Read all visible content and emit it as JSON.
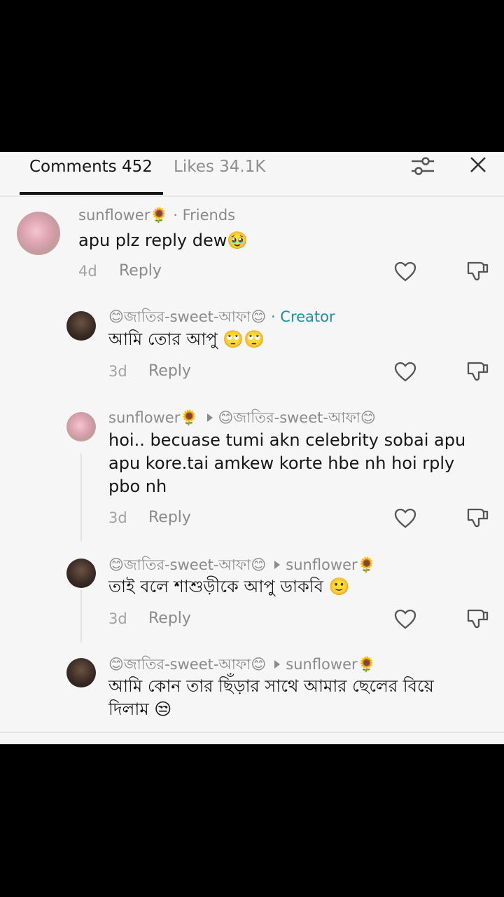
{
  "tabs": {
    "comments": "Comments 452",
    "likes": "Likes 34.1K"
  },
  "comments": [
    {
      "username": "sunflower",
      "user_emoji": "🌻",
      "badge": "· Friends",
      "text": "apu plz reply dew🥹",
      "age": "4d",
      "reply_label": "Reply"
    },
    {
      "username": "😊জাতির-sweet-আফা😊",
      "badge": "· Creator",
      "text": "আমি তোর আপু 🙄🙄",
      "age": "3d",
      "reply_label": "Reply"
    },
    {
      "username": "sunflower",
      "user_emoji": "🌻",
      "reply_to": "😊জাতির-sweet-আফা😊",
      "text": "hoi.. becuase tumi akn celebrity sobai apu apu kore.tai amkew korte hbe nh hoi rply pbo nh",
      "age": "3d",
      "reply_label": "Reply"
    },
    {
      "username": "😊জাতির-sweet-আফা😊",
      "reply_to": "sunflower",
      "reply_to_emoji": "🌻",
      "text": "তাই বলে শাশুড়ীকে আপু ডাকবি 🙂",
      "age": "3d",
      "reply_label": "Reply"
    },
    {
      "username": "😊জাতির-sweet-আফা😊",
      "reply_to": "sunflower",
      "reply_to_emoji": "🌻",
      "text": "আমি কোন তার ছিঁড়ার সাথে আমার ছেলের বিয়ে দিলাম 😒"
    }
  ],
  "icons": {
    "filter": "filter-sliders-icon",
    "close": "close-icon",
    "like": "heart-outline-icon",
    "dislike": "thumbs-down-outline-icon"
  },
  "colors": {
    "creator": "#1f8fa0",
    "text": "#161616",
    "muted": "#8a8a8a",
    "background": "#f6f6f6"
  }
}
